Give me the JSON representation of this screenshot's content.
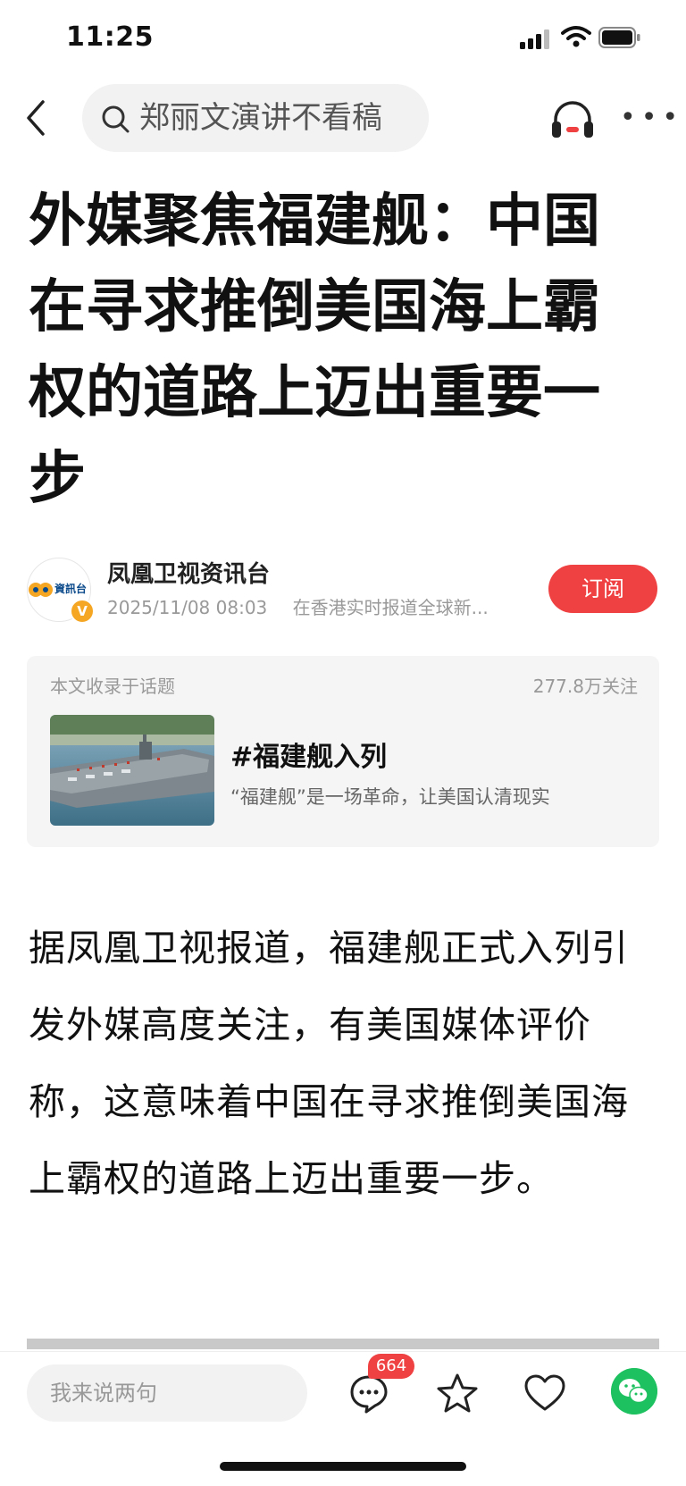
{
  "status_bar": {
    "time": "11:25"
  },
  "nav": {
    "search_text": "郑丽文演讲不看稿"
  },
  "article": {
    "title": "外媒聚焦福建舰：中国在寻求推倒美国海上霸权的道路上迈出重要一步",
    "body": "据凤凰卫视报道，福建舰正式入列引发外媒高度关注，有美国媒体评价称，这意味着中国在寻求推倒美国海上霸权的道路上迈出重要一步。"
  },
  "author": {
    "name": "凤凰卫视资讯台",
    "avatar_text": "資訊台",
    "verified_text": "V",
    "datetime": "2025/11/08 08:03",
    "description": "在香港实时报道全球新...",
    "subscribe_label": "订阅"
  },
  "topic": {
    "header": "本文收录于话题",
    "followers": "277.8万关注",
    "title": "#福建舰入列",
    "description": "“福建舰”是一场革命，让美国认清现实"
  },
  "bottom_bar": {
    "comment_placeholder": "我来说两句",
    "comment_count": "664"
  },
  "colors": {
    "accent_red": "#f04142",
    "wechat_green": "#1ec15f",
    "verified_orange": "#f5a623"
  },
  "icons": [
    "back-icon",
    "search-icon",
    "headphone-icon",
    "more-icon",
    "comment-icon",
    "star-icon",
    "heart-icon",
    "wechat-icon"
  ]
}
